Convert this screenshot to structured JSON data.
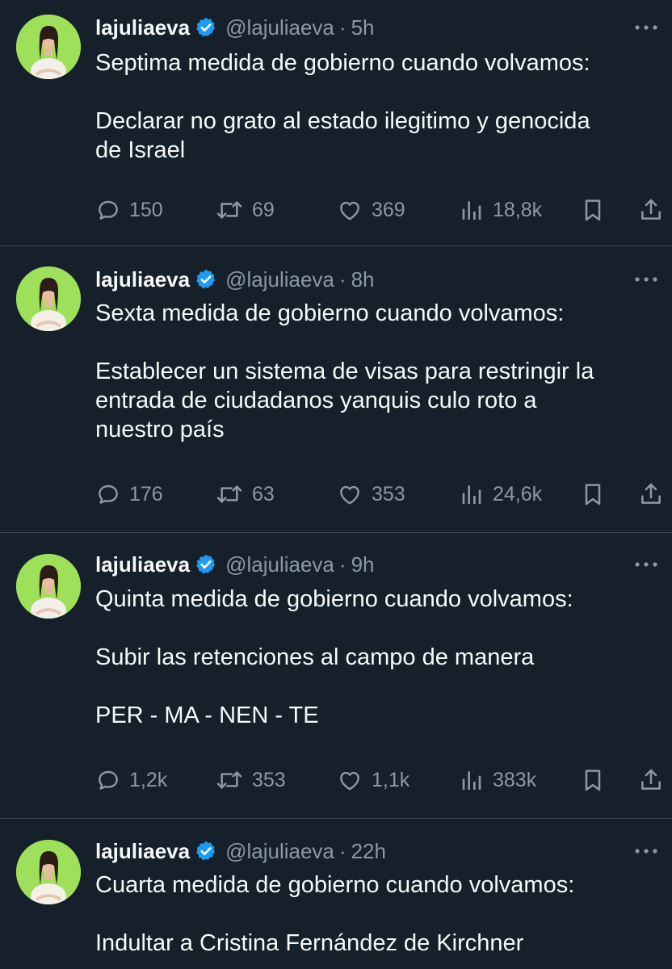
{
  "colors": {
    "background": "#15202b",
    "text": "#f7f9f9",
    "secondary": "#8b98a5",
    "divider": "#38444d",
    "verified": "#1d9bf0",
    "avatar_bg": "#9fe05a"
  },
  "tweets": [
    {
      "name": "lajuliaeva",
      "handle": "@lajuliaeva",
      "separator": "·",
      "time": "5h",
      "lines": [
        "Septima medida de gobierno cuando volvamos:",
        "",
        "Declarar no grato al estado ilegitimo y genocida",
        "de Israel"
      ],
      "stats": {
        "replies": "150",
        "retweets": "69",
        "likes": "369",
        "views": "18,8k"
      }
    },
    {
      "name": "lajuliaeva",
      "handle": "@lajuliaeva",
      "separator": "·",
      "time": "8h",
      "lines": [
        "Sexta medida de gobierno cuando volvamos:",
        "",
        "Establecer un sistema de visas para restringir la",
        "entrada de ciudadanos yanquis culo roto a",
        "nuestro país"
      ],
      "stats": {
        "replies": "176",
        "retweets": "63",
        "likes": "353",
        "views": "24,6k"
      }
    },
    {
      "name": "lajuliaeva",
      "handle": "@lajuliaeva",
      "separator": "·",
      "time": "9h",
      "lines": [
        "Quinta medida de gobierno cuando volvamos:",
        "",
        "Subir las retenciones al campo de manera",
        "",
        "PER - MA - NEN - TE"
      ],
      "stats": {
        "replies": "1,2k",
        "retweets": "353",
        "likes": "1,1k",
        "views": "383k"
      }
    },
    {
      "name": "lajuliaeva",
      "handle": "@lajuliaeva",
      "separator": "·",
      "time": "22h",
      "lines": [
        "Cuarta medida de gobierno cuando volvamos:",
        "",
        "Indultar a Cristina Fernández de Kirchner"
      ]
    }
  ],
  "icons": {
    "reply": "reply-icon",
    "retweet": "retweet-icon",
    "like": "heart-icon",
    "views": "views-icon",
    "bookmark": "bookmark-icon",
    "share": "share-icon",
    "more": "more-icon",
    "verified": "verified-badge-icon"
  }
}
